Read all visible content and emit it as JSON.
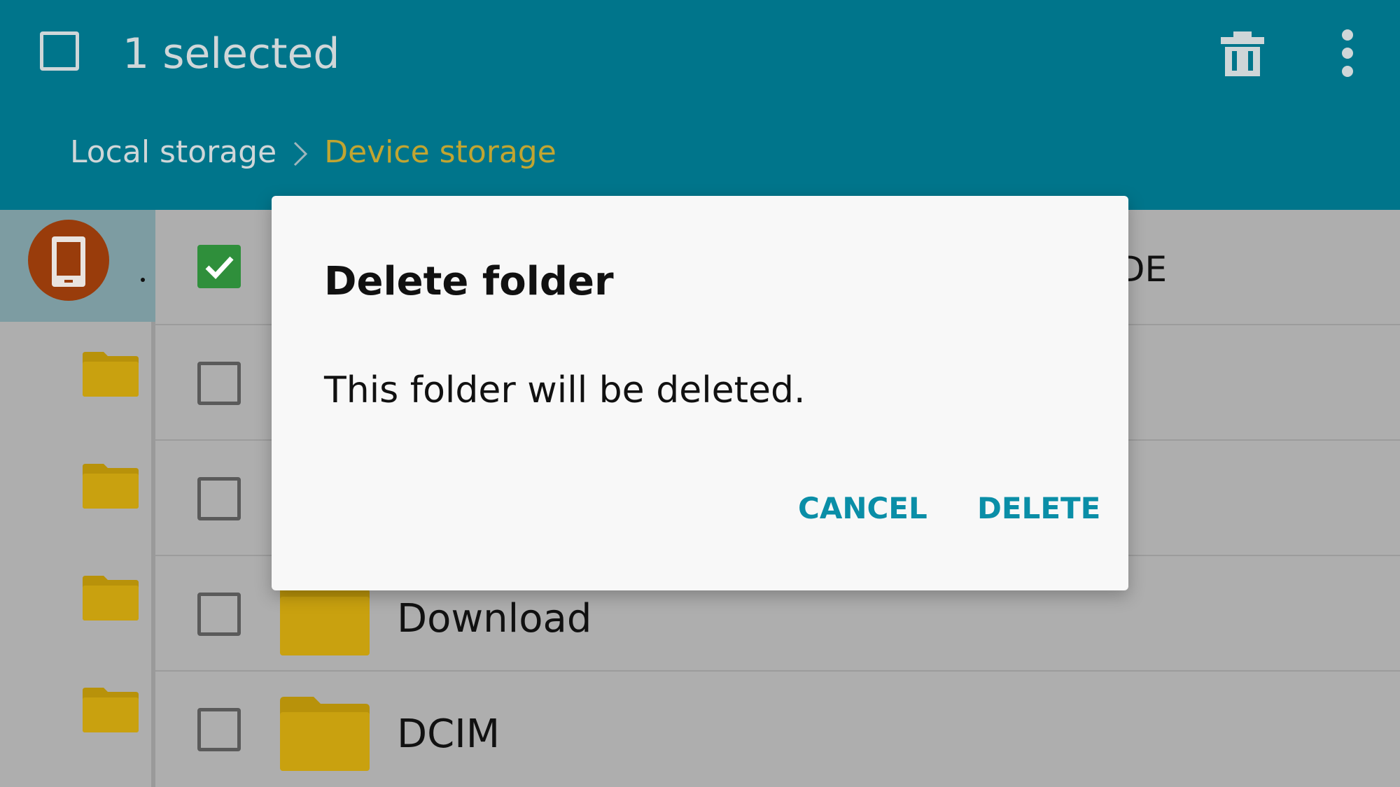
{
  "app_bar": {
    "selected_label": "1 selected",
    "icons": [
      "checkbox-icon",
      "trash-icon",
      "more-vert-icon"
    ]
  },
  "breadcrumb": {
    "root": "Local storage",
    "current": "Device storage"
  },
  "sidebar": {
    "active_item_icon": "phone-icon"
  },
  "list": {
    "rows": [
      {
        "name": "",
        "checked": true,
        "trailing": "DE"
      },
      {
        "name": "",
        "checked": false
      },
      {
        "name": "",
        "checked": false
      },
      {
        "name": "Download",
        "checked": false
      },
      {
        "name": "DCIM",
        "checked": false
      }
    ]
  },
  "dialog": {
    "title": "Delete folder",
    "message": "This folder will be deleted.",
    "cancel_label": "CANCEL",
    "delete_label": "DELETE"
  },
  "colors": {
    "app_bar": "#00758b",
    "accent_text": "#c1a531",
    "dialog_button": "#0a8ea7",
    "folder": "#b8920a",
    "checked": "#2f8f3b",
    "device_avatar": "#993c0b"
  }
}
